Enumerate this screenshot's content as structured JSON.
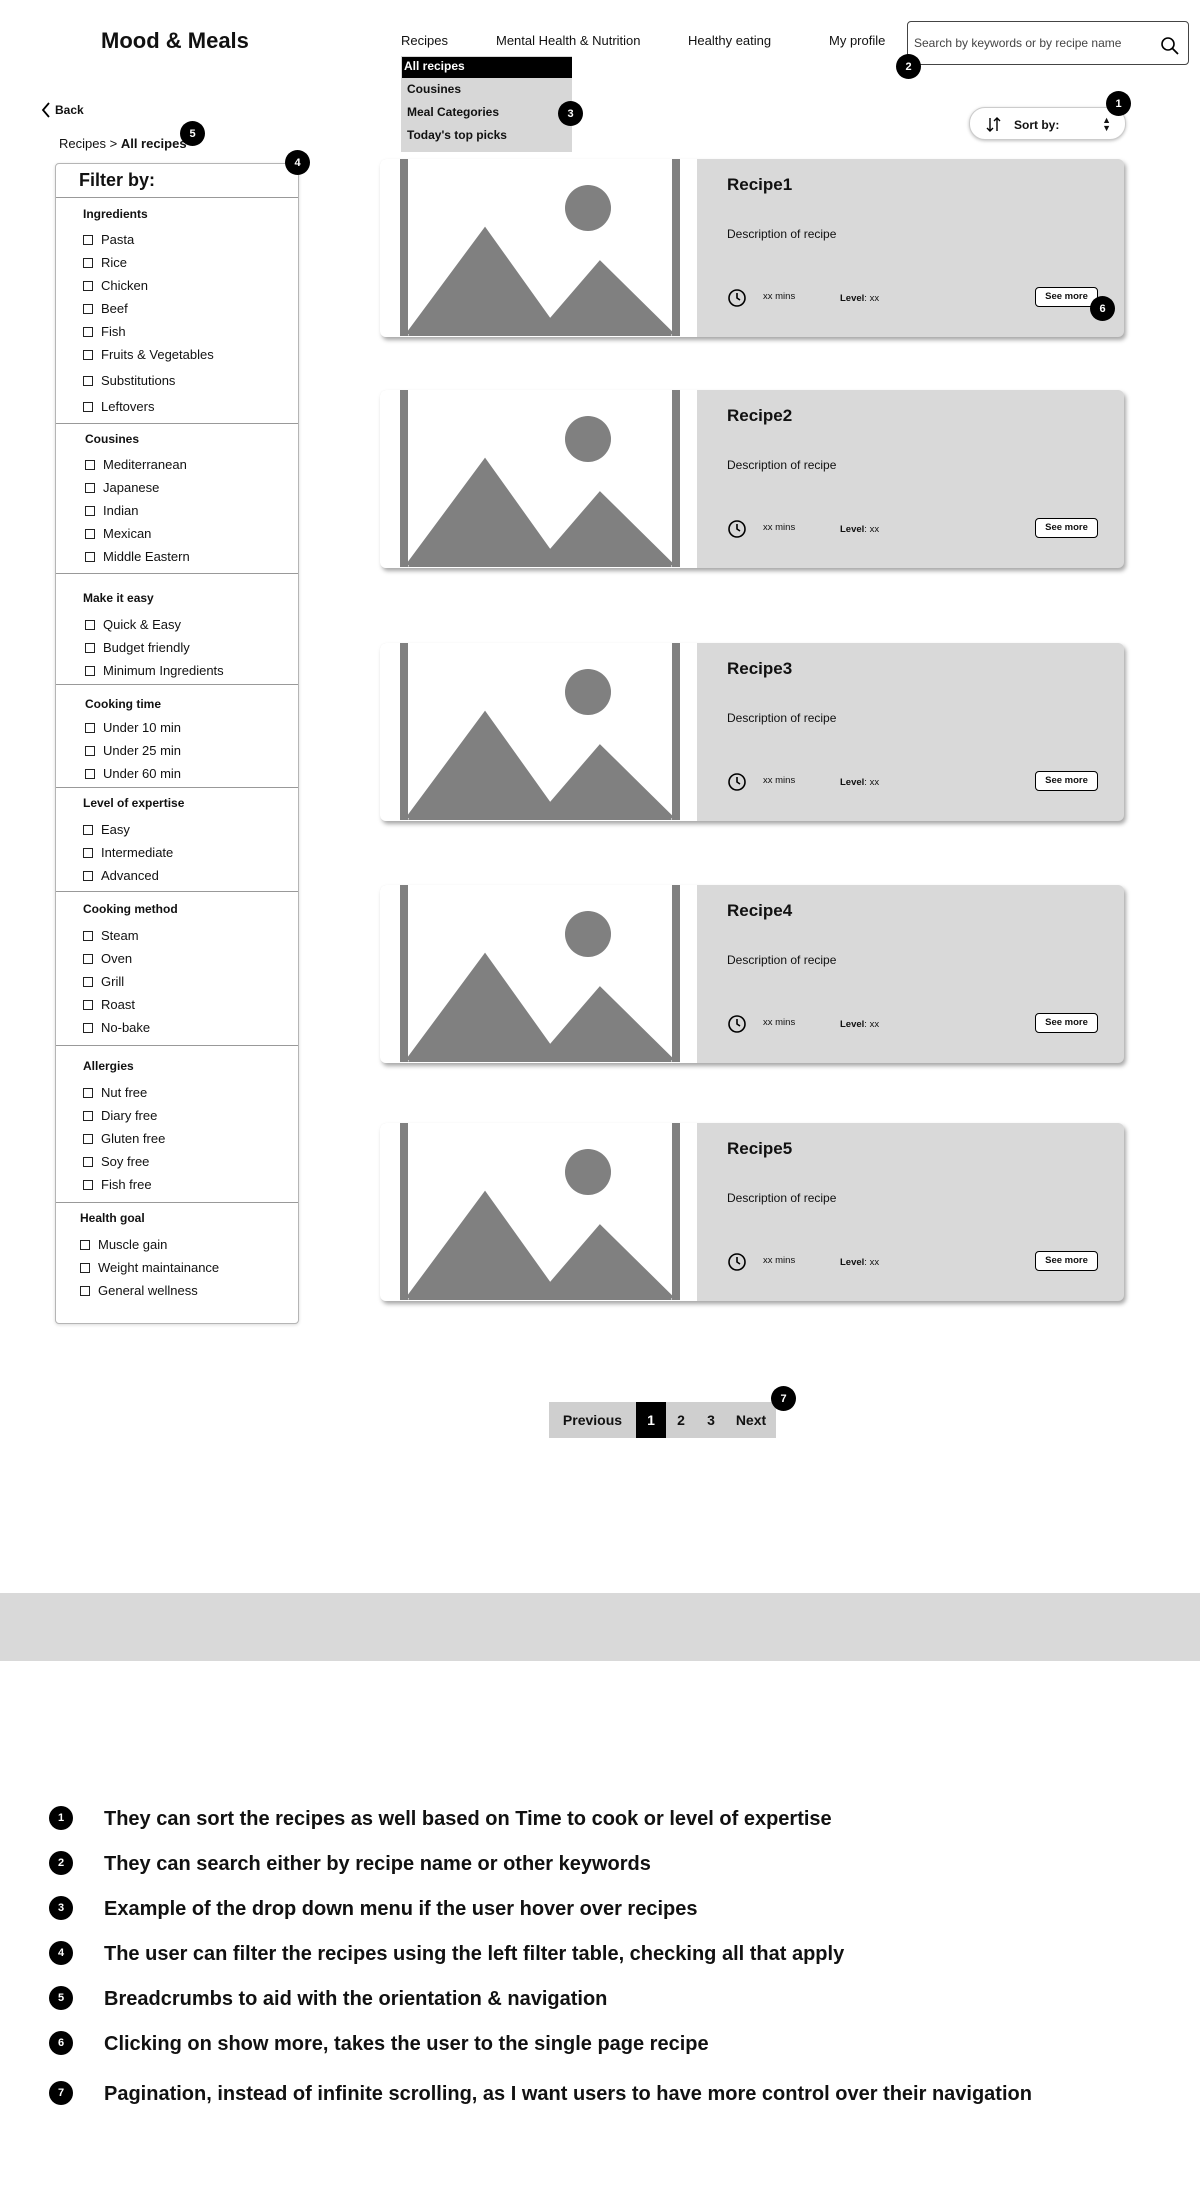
{
  "header": {
    "logo": "Mood & Meals",
    "nav": [
      "Recipes",
      "Mental Health & Nutrition",
      "Healthy eating",
      "My profile"
    ],
    "search_placeholder": "Search by keywords or by recipe name"
  },
  "dropdown": {
    "items": [
      "All recipes",
      "Cousines",
      "Meal Categories",
      "Today's top picks"
    ]
  },
  "back_label": "Back",
  "breadcrumb": {
    "root": "Recipes",
    "separator": ">",
    "current": "All recipes"
  },
  "sort": {
    "label": "Sort by:"
  },
  "filter": {
    "title": "Filter by:",
    "sections": [
      {
        "title": "Ingredients",
        "options": [
          "Pasta",
          "Rice",
          "Chicken",
          "Beef",
          "Fish",
          "Fruits & Vegetables",
          "Substitutions",
          "Leftovers"
        ]
      },
      {
        "title": "Cousines",
        "options": [
          "Mediterranean",
          "Japanese",
          "Indian",
          "Mexican",
          "Middle Eastern"
        ]
      },
      {
        "title": "Make it easy",
        "options": [
          "Quick & Easy",
          "Budget friendly",
          "Minimum Ingredients"
        ]
      },
      {
        "title": "Cooking time",
        "options": [
          "Under 10 min",
          "Under 25 min",
          "Under 60 min"
        ]
      },
      {
        "title": "Level of expertise",
        "options": [
          "Easy",
          "Intermediate",
          "Advanced"
        ]
      },
      {
        "title": "Cooking method",
        "options": [
          "Steam",
          "Oven",
          "Grill",
          "Roast",
          "No-bake"
        ]
      },
      {
        "title": "Allergies",
        "options": [
          "Nut free",
          "Diary free",
          "Gluten free",
          "Soy free",
          "Fish free"
        ]
      },
      {
        "title": "Health goal",
        "options": [
          "Muscle gain",
          "Weight maintainance",
          "General wellness"
        ]
      }
    ]
  },
  "recipes": [
    {
      "name": "Recipe1",
      "description": "Description of recipe",
      "time": "xx mins",
      "level_label": "Level",
      "level_value": ": xx",
      "button": "See more"
    },
    {
      "name": "Recipe2",
      "description": "Description of recipe",
      "time": "xx mins",
      "level_label": "Level",
      "level_value": ": xx",
      "button": "See more"
    },
    {
      "name": "Recipe3",
      "description": "Description of recipe",
      "time": "xx mins",
      "level_label": "Level",
      "level_value": ": xx",
      "button": "See more"
    },
    {
      "name": "Recipe4",
      "description": "Description of recipe",
      "time": "xx mins",
      "level_label": "Level",
      "level_value": ": xx",
      "button": "See more"
    },
    {
      "name": "Recipe5",
      "description": "Description of recipe",
      "time": "xx mins",
      "level_label": "Level",
      "level_value": ": xx",
      "button": "See more"
    }
  ],
  "pagination": {
    "previous": "Previous",
    "pages": [
      "1",
      "2",
      "3"
    ],
    "current_page": "1",
    "next": "Next"
  },
  "markers": [
    "1",
    "2",
    "3",
    "4",
    "5",
    "6",
    "7"
  ],
  "notes": [
    {
      "num": "1",
      "text": "They can sort the recipes as well based on Time to cook or level of expertise"
    },
    {
      "num": "2",
      "text": "They can search either by recipe name or other keywords"
    },
    {
      "num": "3",
      "text": "Example of the drop down menu if the user hover over recipes"
    },
    {
      "num": "4",
      "text": "The user can filter the recipes using the left filter table, checking all that apply"
    },
    {
      "num": "5",
      "text": "Breadcrumbs to aid with the orientation & navigation"
    },
    {
      "num": "6",
      "text": "Clicking on show more, takes the user to the single page recipe"
    },
    {
      "num": "7",
      "text": "Pagination, instead of infinite scrolling, as I want users to have more control over their navigation"
    }
  ],
  "colors": {
    "placeholder_gray": "#808080",
    "card_bg": "#d9d9d9",
    "dropdown_bg": "#d7d7d7"
  }
}
